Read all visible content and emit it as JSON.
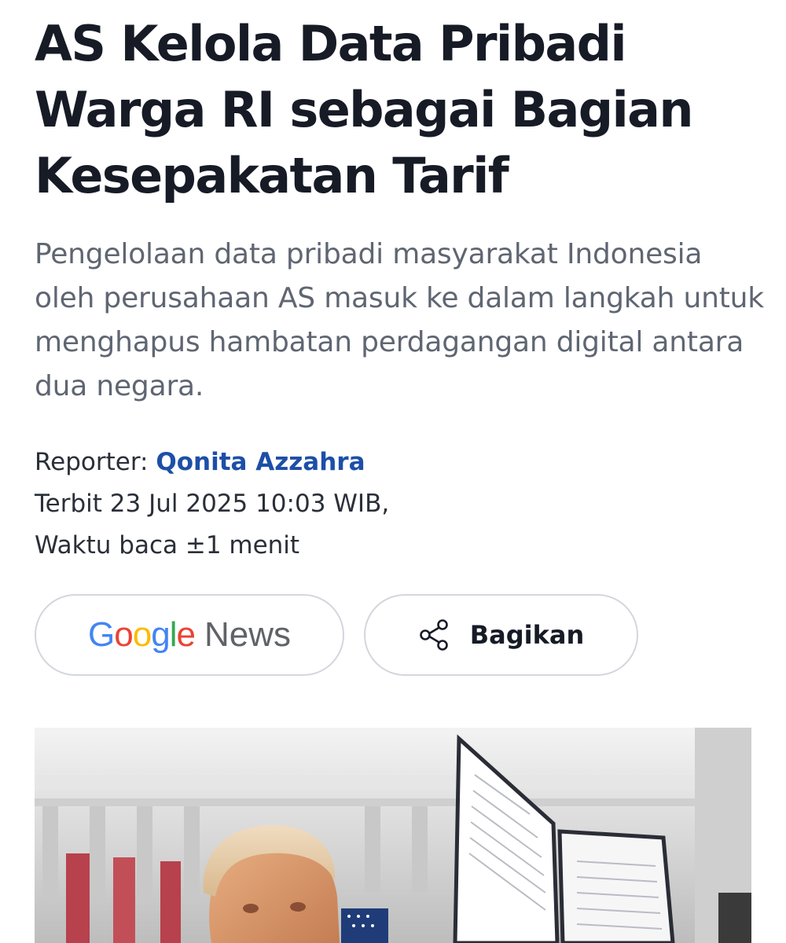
{
  "article": {
    "title": "AS Kelola Data Pribadi Warga RI sebagai Bagian Kesepakatan Tarif",
    "lead": "Pengelolaan data pribadi masyarakat Indonesia oleh perusahaan AS masuk ke dalam langkah untuk menghapus hambatan perdagangan digital antara dua negara.",
    "reporter_label": "Reporter:",
    "reporter_name": "Qonita Azzahra",
    "published": "Terbit 23 Jul 2025 10:03 WIB,",
    "read_time": "Waktu baca ±1 menit"
  },
  "actions": {
    "google_news": {
      "letters": [
        {
          "char": "G",
          "color": "#4285F4"
        },
        {
          "char": "o",
          "color": "#EA4335"
        },
        {
          "char": "o",
          "color": "#FBBC05"
        },
        {
          "char": "g",
          "color": "#4285F4"
        },
        {
          "char": "l",
          "color": "#34A853"
        },
        {
          "char": "e",
          "color": "#EA4335"
        }
      ],
      "news_label": "News"
    },
    "share": {
      "label": "Bagikan",
      "icon": "share-icon"
    }
  },
  "colors": {
    "headline": "#161b26",
    "lead": "#5f6672",
    "author_link": "#1d4fa8"
  }
}
